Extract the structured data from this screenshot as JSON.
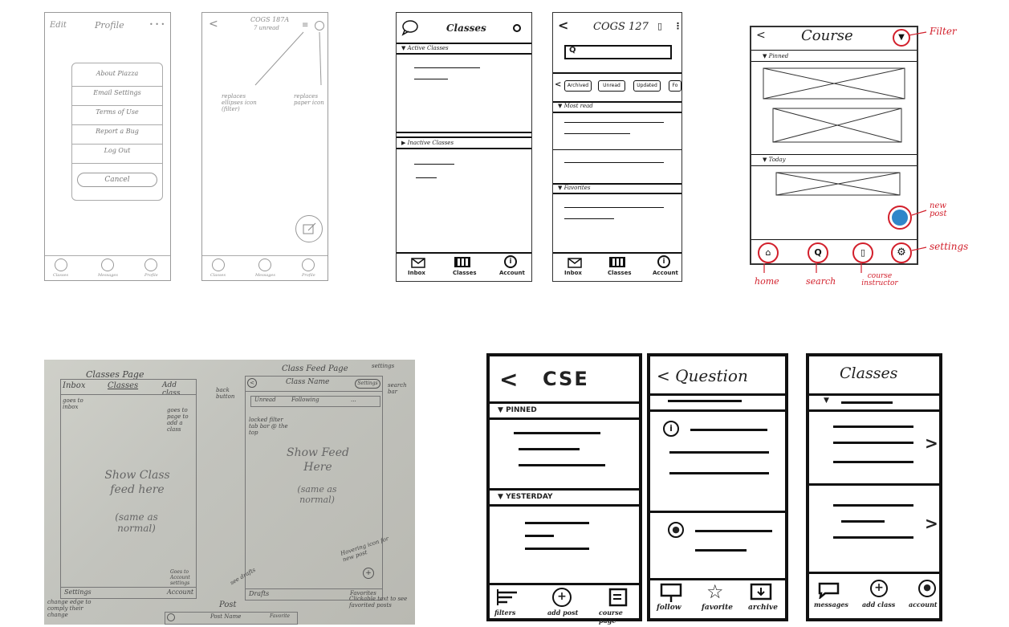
{
  "s1": {
    "edit": "Edit",
    "title": "Profile",
    "dots": "• • •",
    "menu": [
      "About Piazza",
      "Email Settings",
      "Terms of Use",
      "Report a Bug",
      "Log Out"
    ],
    "cancel": "Cancel",
    "nav": [
      "Classes",
      "Messages",
      "Profile"
    ]
  },
  "s2": {
    "back": "<",
    "title": "COGS 187A",
    "sub": "7 unread",
    "note1": "replaces\nellipses icon\n(filter)",
    "note2": "replaces\npaper icon",
    "nav": [
      "Classes",
      "Messages",
      "Profile"
    ]
  },
  "s3": {
    "title": "Classes",
    "active": "Active Classes",
    "inactive": "Inactive Classes",
    "nav": [
      "Inbox",
      "Classes",
      "Account"
    ]
  },
  "s4": {
    "back": "<",
    "title": "COGS 127",
    "chips": [
      "Archived",
      "Unread",
      "Updated",
      "Fo"
    ],
    "most": "Most read",
    "fav": "Favorites",
    "nav": [
      "Inbox",
      "Classes",
      "Account"
    ]
  },
  "s5": {
    "back": "<",
    "title": "Course",
    "pinned": "Pinned",
    "today": "Today",
    "annotations": {
      "filter": "Filter",
      "newpost": "new post",
      "settings": "settings",
      "home": "home",
      "search": "search",
      "course": "course instructor"
    }
  },
  "s6": {
    "classes_page": "Classes Page",
    "inbox": "Inbox",
    "classes": "Classes",
    "add": "Add class",
    "goes_inbox": "goes to inbox",
    "goes_page": "goes to page to add a class",
    "show": "Show Class feed here",
    "same": "(same as normal)",
    "settings": "Settings",
    "account": "Account",
    "goes_acc": "Goes to Account settings",
    "change": "change edge to comply their change",
    "feed_page": "Class Feed Page",
    "class_name": "Class Name",
    "settings2": "Settings",
    "settings_note": "settings",
    "search_bar": "search bar",
    "back_button": "back button",
    "tabs": [
      "Unread",
      "Following",
      "..."
    ],
    "locked": "locked filter tab bar @ the top",
    "show_feed": "Show Feed Here",
    "same2": "(same as normal)",
    "hover": "Hovering icon for new post",
    "drafts": "Drafts",
    "favorites": "Favorites",
    "see_drafts": "see drafts",
    "clickable": "Clickable text to see favorited posts",
    "post": "Post",
    "post_name": "Post Name",
    "fav2": "Favorite"
  },
  "s7": {
    "back": "<",
    "title": "CSE",
    "pinned": "PINNED",
    "yesterday": "YESTERDAY",
    "nav": [
      "filters",
      "add post",
      "course page"
    ]
  },
  "s8": {
    "title": "< Question",
    "nav": [
      "follow",
      "favorite",
      "archive"
    ]
  },
  "s9": {
    "title": "Classes",
    "nav": [
      "messages",
      "add class",
      "account"
    ]
  }
}
